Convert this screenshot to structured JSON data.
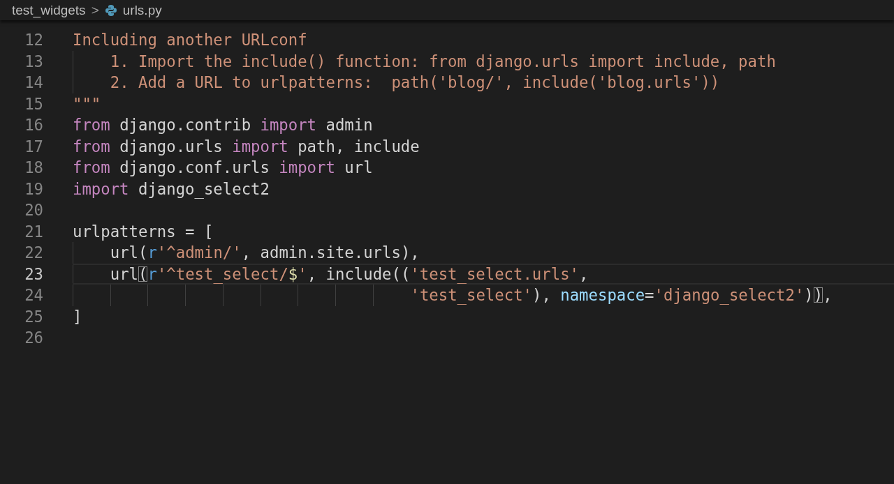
{
  "breadcrumb": {
    "folder": "test_widgets",
    "separator": ">",
    "file": "urls.py"
  },
  "lines": [
    {
      "number": "12",
      "current": false,
      "tokens": [
        {
          "text": "Including another URLconf",
          "kind": "string"
        }
      ]
    },
    {
      "number": "13",
      "current": false,
      "tokens": [
        {
          "text": "    1. Import the include() function: from django.urls import include, path",
          "kind": "string"
        }
      ]
    },
    {
      "number": "14",
      "current": false,
      "tokens": [
        {
          "text": "    2. Add a URL to urlpatterns:  path('blog/', include('blog.urls'))",
          "kind": "string"
        }
      ]
    },
    {
      "number": "15",
      "current": false,
      "tokens": [
        {
          "text": "\"\"\"",
          "kind": "string"
        }
      ]
    },
    {
      "number": "16",
      "current": false,
      "tokens": [
        {
          "text": "from",
          "kind": "keyword"
        },
        {
          "text": " django.contrib ",
          "kind": "plain"
        },
        {
          "text": "import",
          "kind": "keyword"
        },
        {
          "text": " admin",
          "kind": "plain"
        }
      ]
    },
    {
      "number": "17",
      "current": false,
      "tokens": [
        {
          "text": "from",
          "kind": "keyword"
        },
        {
          "text": " django.urls ",
          "kind": "plain"
        },
        {
          "text": "import",
          "kind": "keyword"
        },
        {
          "text": " path, include",
          "kind": "plain"
        }
      ]
    },
    {
      "number": "18",
      "current": false,
      "tokens": [
        {
          "text": "from",
          "kind": "keyword"
        },
        {
          "text": " django.conf.urls ",
          "kind": "plain"
        },
        {
          "text": "import",
          "kind": "keyword"
        },
        {
          "text": " url",
          "kind": "plain"
        }
      ]
    },
    {
      "number": "19",
      "current": false,
      "tokens": [
        {
          "text": "import",
          "kind": "keyword"
        },
        {
          "text": " django_select2",
          "kind": "plain"
        }
      ]
    },
    {
      "number": "20",
      "current": false
    },
    {
      "number": "21",
      "current": false,
      "tokens": [
        {
          "text": "urlpatterns = [",
          "kind": "plain"
        }
      ]
    },
    {
      "number": "22",
      "current": false,
      "tokens": [
        {
          "text": "    url(",
          "kind": "plain"
        },
        {
          "text": "r",
          "kind": "prefix"
        },
        {
          "text": "'^admin/'",
          "kind": "string"
        },
        {
          "text": ", admin.site.urls),",
          "kind": "plain"
        }
      ]
    },
    {
      "number": "23",
      "current": true,
      "tokens": [
        {
          "text": "    url",
          "kind": "plain"
        },
        {
          "text": "(",
          "kind": "matched_bracket"
        },
        {
          "text": "r",
          "kind": "prefix"
        },
        {
          "text": "'^test_select/",
          "kind": "string"
        },
        {
          "text": "$",
          "kind": "regex"
        },
        {
          "text": "'",
          "kind": "string"
        },
        {
          "text": ", include((",
          "kind": "plain"
        },
        {
          "text": "'test_select.urls'",
          "kind": "string"
        },
        {
          "text": ",",
          "kind": "plain"
        }
      ]
    },
    {
      "number": "24",
      "current": false,
      "tokens": [
        {
          "text": "                                    'test_select'",
          "kind": "string"
        },
        {
          "text": "), ",
          "kind": "plain"
        },
        {
          "text": "namespace",
          "kind": "param"
        },
        {
          "text": "=",
          "kind": "plain"
        },
        {
          "text": "'django_select2'",
          "kind": "string"
        },
        {
          "text": ")",
          "kind": "plain"
        },
        {
          "text": ")",
          "kind": "matched_bracket"
        },
        {
          "text": ",",
          "kind": "plain"
        }
      ]
    },
    {
      "number": "25",
      "current": false,
      "tokens": [
        {
          "text": "]",
          "kind": "plain"
        }
      ]
    },
    {
      "number": "26",
      "current": false
    }
  ]
}
